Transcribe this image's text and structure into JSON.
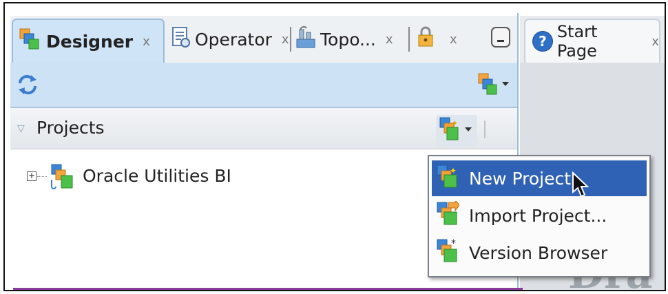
{
  "tabs": [
    {
      "label": "Designer",
      "close": "x",
      "active": true
    },
    {
      "label": "Operator",
      "close": "x"
    },
    {
      "label": "Topo...",
      "close": "x"
    },
    {
      "label": "",
      "close": "x"
    }
  ],
  "right_tab": {
    "label": "Start Page",
    "close": "x"
  },
  "projects": {
    "title": "Projects"
  },
  "tree": {
    "items": [
      {
        "label": "Oracle Utilities BI"
      }
    ]
  },
  "menu": {
    "items": [
      {
        "label": "New Project",
        "selected": true
      },
      {
        "label": "Import Project..."
      },
      {
        "label": "Version Browser"
      }
    ]
  },
  "watermark": "Dra",
  "colors": {
    "selection": "#2f62b5",
    "toolbar": "#cde3f5",
    "accent_purple": "#8a3c9a"
  }
}
